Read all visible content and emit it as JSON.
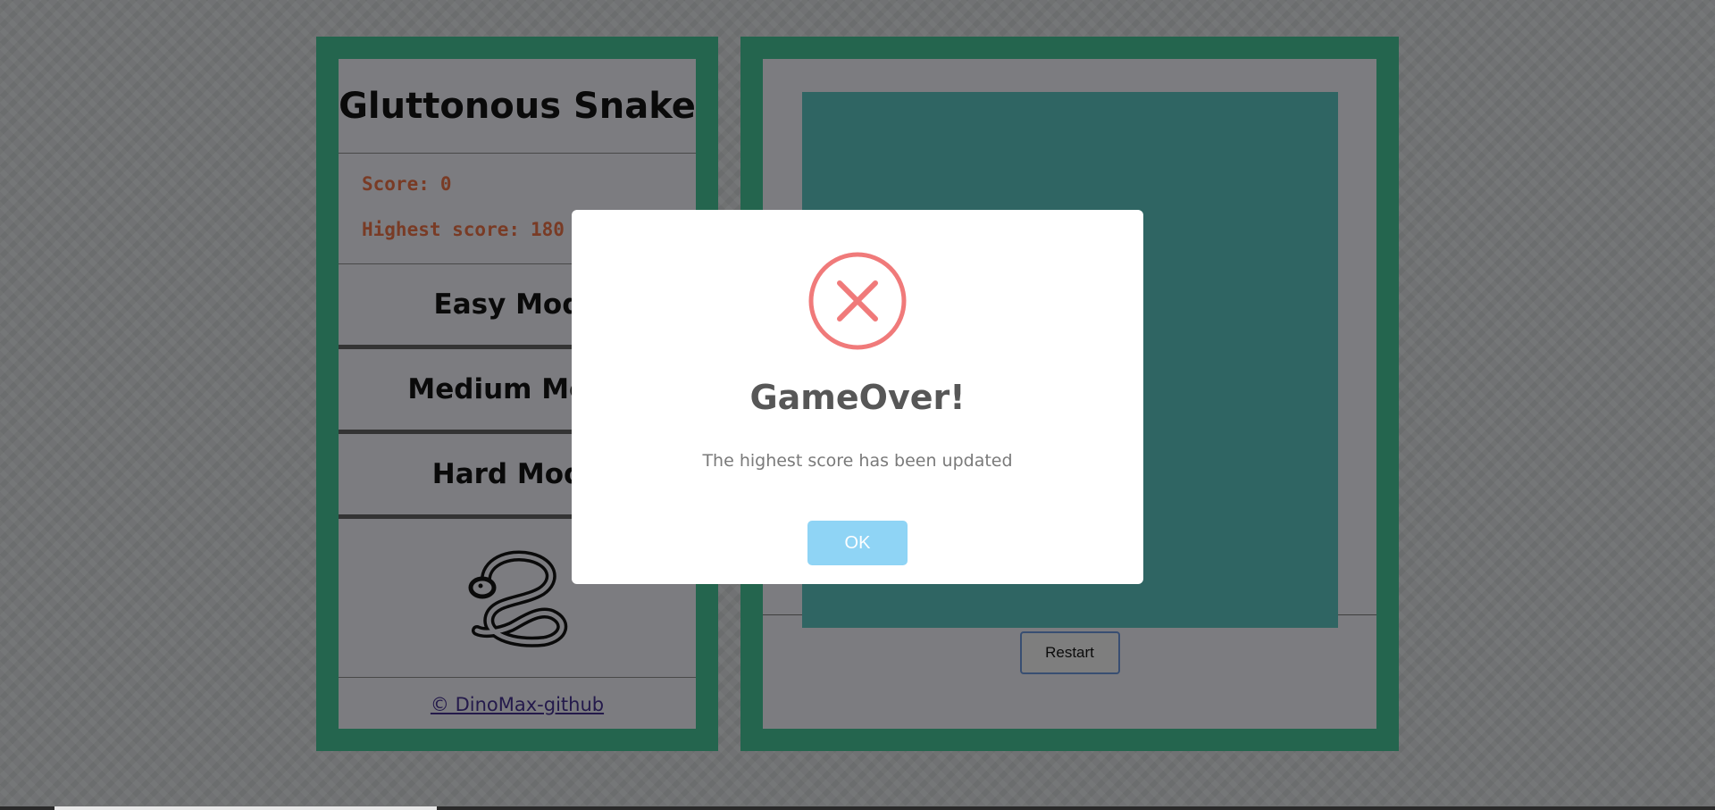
{
  "app": {
    "title": "Gluttonous Snake"
  },
  "scoreboard": {
    "score_label": "Score:",
    "score_value": "0",
    "highest_label": "Highest score:",
    "highest_value": "180"
  },
  "modes": [
    {
      "label": "Easy Mode"
    },
    {
      "label": "Medium Mode"
    },
    {
      "label": "Hard Mode"
    }
  ],
  "logo": {
    "icon": "snake-icon"
  },
  "footer": {
    "link_text": "© DinoMax-github"
  },
  "game": {
    "restart_label": "Restart",
    "board_color": "#4da3a0"
  },
  "modal": {
    "icon": "error-x-icon",
    "title": "GameOver!",
    "message": "The highest score has been updated",
    "ok_label": "OK"
  },
  "colors": {
    "frame": "#3aa37f",
    "panel": "#c9c9cf",
    "score_text": "#c4603d",
    "error_icon": "#f07a7a",
    "ok_button": "#8fd4f5"
  }
}
